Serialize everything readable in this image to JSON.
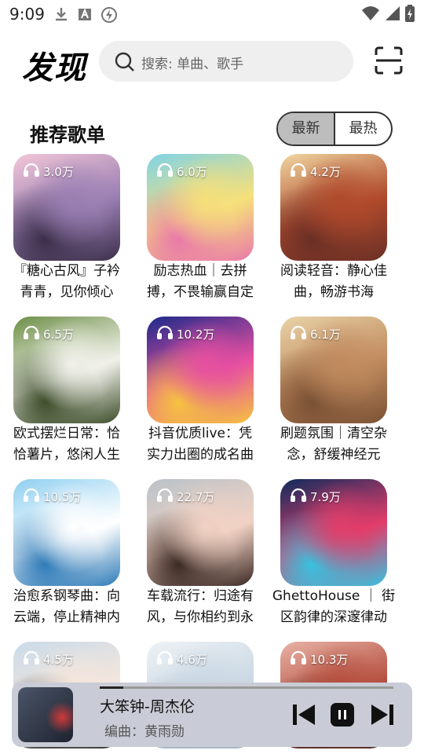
{
  "status": {
    "time": "9:09"
  },
  "header": {
    "title": "发现",
    "search_placeholder": "搜索: 单曲、歌手"
  },
  "section": {
    "title": "推荐歌单",
    "tabs": [
      "最新",
      "最热"
    ],
    "active_tab": 0
  },
  "playlists": [
    {
      "count": "3.0万",
      "line1": "『糖心古风』子衿",
      "line2": "青青，见你倾心",
      "colors": [
        "#f3c7d8",
        "#9a7fb3",
        "#3c2f4a"
      ]
    },
    {
      "count": "6.0万",
      "line1": "励志热血｜去拼",
      "line2": "搏，不畏输赢自定",
      "colors": [
        "#7fd3e6",
        "#f6e07a",
        "#e979a9"
      ]
    },
    {
      "count": "4.2万",
      "line1": "阅读轻音：静心佳",
      "line2": "曲，畅游书海",
      "colors": [
        "#f0d7a1",
        "#b04a2c",
        "#6a2f25"
      ]
    },
    {
      "count": "6.5万",
      "line1": "欧式摆烂日常：恰",
      "line2": "恰薯片，悠闲人生",
      "colors": [
        "#6d8f47",
        "#f1f1ea",
        "#3d4d2a"
      ]
    },
    {
      "count": "10.2万",
      "line1": "抖音优质live：凭",
      "line2": "实力出圈的成名曲",
      "colors": [
        "#1b2a8a",
        "#e64fa1",
        "#f5c33f"
      ]
    },
    {
      "count": "6.1万",
      "line1": "刷题氛围｜清空杂",
      "line2": "念，舒缓神经元",
      "colors": [
        "#e9d3a8",
        "#c08a5e",
        "#7a5134"
      ]
    },
    {
      "count": "10.5万",
      "line1": "治愈系钢琴曲：向",
      "line2": "云端，停止精神内",
      "colors": [
        "#8fcff1",
        "#ffffff",
        "#2f7bb8"
      ]
    },
    {
      "count": "22.7万",
      "line1": "车载流行：归途有",
      "line2": "风，与你相约到永",
      "colors": [
        "#b9c2c9",
        "#f1d2c4",
        "#3b2a24"
      ]
    },
    {
      "count": "7.9万",
      "line1": "GhettoHouse ｜ 街",
      "line2": "区韵律的深邃律动",
      "colors": [
        "#0e2b5c",
        "#e23d6a",
        "#37c2e0"
      ]
    },
    {
      "count": "4.5万",
      "line1": "",
      "line2": "",
      "colors": [
        "#c9dbe9",
        "#f5e6dc",
        "#2a2a2a"
      ]
    },
    {
      "count": "4.6万",
      "line1": "",
      "line2": "",
      "colors": [
        "#eef2f5",
        "#c9d7e3",
        "#9fb2c4"
      ]
    },
    {
      "count": "10.3万",
      "line1": "",
      "line2": "",
      "colors": [
        "#e7b3a6",
        "#b44c3c",
        "#4a2c24"
      ]
    }
  ],
  "player": {
    "title": "大笨钟-周杰伦",
    "subtitle": "编曲：黄雨勋",
    "progress": 0.08,
    "cover_colors": [
      "#1f2330",
      "#4a5568",
      "#d13a3a"
    ]
  }
}
